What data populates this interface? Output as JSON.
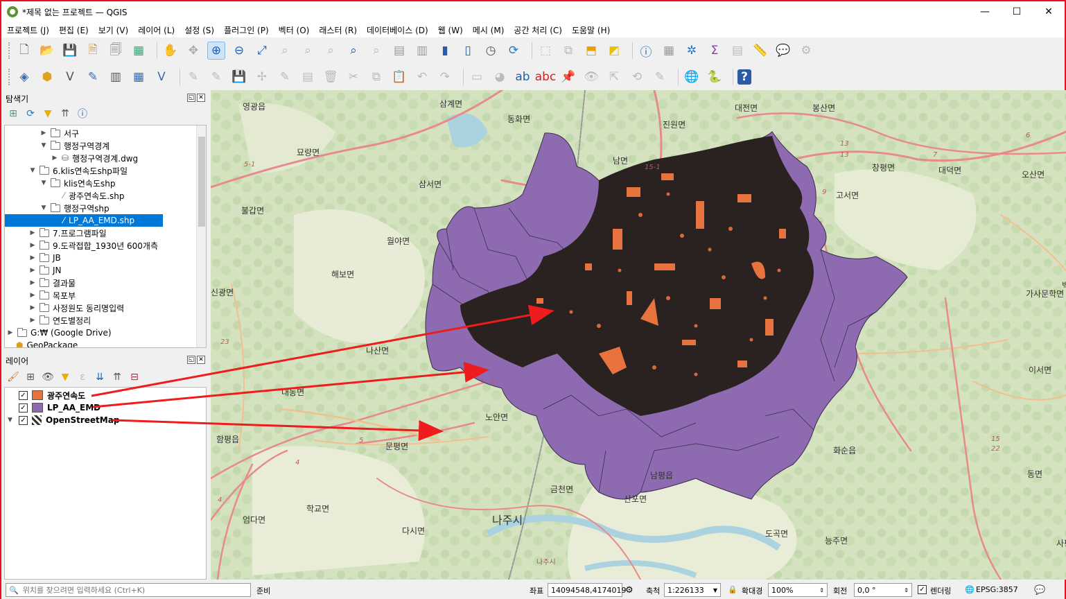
{
  "window": {
    "title": "*제목 없는 프로젝트 — QGIS",
    "minimize": "—",
    "maximize": "☐",
    "close": "✕"
  },
  "menu": [
    "프로젝트 (J)",
    "편집 (E)",
    "보기 (V)",
    "레이어 (L)",
    "설정 (S)",
    "플러그인 (P)",
    "벡터 (O)",
    "래스터 (R)",
    "데이터베이스 (D)",
    "웹 (W)",
    "메시 (M)",
    "공간 처리 (C)",
    "도움말 (H)"
  ],
  "browser_panel": {
    "title": "탐색기",
    "tree": [
      {
        "label": "서구",
        "level": 3,
        "arrow": "▶",
        "kind": "folder"
      },
      {
        "label": "행정구역경계",
        "level": 3,
        "arrow": "▼",
        "kind": "folder"
      },
      {
        "label": "행정구역경계.dwg",
        "level": 4,
        "arrow": "▶",
        "kind": "db"
      },
      {
        "label": "6.klis연속도shp파일",
        "level": 2,
        "arrow": "▼",
        "kind": "folder"
      },
      {
        "label": "klis연속도shp",
        "level": 3,
        "arrow": "▼",
        "kind": "folder"
      },
      {
        "label": "광주연속도.shp",
        "level": 4,
        "arrow": "",
        "kind": "shp"
      },
      {
        "label": "행정구역shp",
        "level": 3,
        "arrow": "▼",
        "kind": "folder"
      },
      {
        "label": "LP_AA_EMD.shp",
        "level": 4,
        "arrow": "",
        "kind": "shp",
        "selected": true
      },
      {
        "label": "7.프로그램파일",
        "level": 2,
        "arrow": "▶",
        "kind": "folder"
      },
      {
        "label": "9.도곽접합_1930년 600개측",
        "level": 2,
        "arrow": "▶",
        "kind": "folder"
      },
      {
        "label": "JB",
        "level": 2,
        "arrow": "▶",
        "kind": "folder"
      },
      {
        "label": "JN",
        "level": 2,
        "arrow": "▶",
        "kind": "folder"
      },
      {
        "label": "결과물",
        "level": 2,
        "arrow": "▶",
        "kind": "folder"
      },
      {
        "label": "목포부",
        "level": 2,
        "arrow": "▶",
        "kind": "folder"
      },
      {
        "label": "사정원도 동리명입력",
        "level": 2,
        "arrow": "▶",
        "kind": "folder"
      },
      {
        "label": "연도별정리",
        "level": 2,
        "arrow": "▶",
        "kind": "folder"
      },
      {
        "label": "G:₩ (Google Drive)",
        "level": 0,
        "arrow": "▶",
        "kind": "folder"
      },
      {
        "label": "GeoPackage",
        "level": 0,
        "arrow": "",
        "kind": "gpkg"
      }
    ]
  },
  "layers_panel": {
    "title": "레이어",
    "layers": [
      {
        "name": "광주연속도",
        "checked": "✓",
        "color": "#e8733f"
      },
      {
        "name": "LP_AA_EMD",
        "checked": "✓",
        "color": "#8e6bb1"
      },
      {
        "name": "OpenStreetMap",
        "checked": "✓",
        "color": "raster"
      }
    ]
  },
  "map_labels": [
    "영광읍",
    "삼계면",
    "동화면",
    "대전면",
    "봉산면",
    "묘량면",
    "진원면",
    "남면",
    "창평면",
    "대덕면",
    "오산면",
    "삼서면",
    "고서면",
    "불갑면",
    "월야면",
    "해보면",
    "가사문학면",
    "백아면",
    "신광면",
    "나산면",
    "이서면",
    "대동면",
    "노안면",
    "함평읍",
    "문평면",
    "화순읍",
    "동면",
    "남평읍",
    "금천면",
    "산포면",
    "학교면",
    "엄다면",
    "나주시",
    "다시면",
    "도곡면",
    "능주면",
    "사평면",
    "나주시"
  ],
  "road_labels": [
    "5-1",
    "15-1",
    "13",
    "13",
    "7",
    "6",
    "9",
    "23",
    "6",
    "4",
    "5",
    "15",
    "22",
    "4"
  ],
  "status": {
    "locator_placeholder": "위치를 찾으려면 입력하세요 (Ctrl+K)",
    "ready": "준비",
    "coord_label": "좌표",
    "coord_value": "14094548,4174019",
    "scale_label": "축척",
    "scale_value": "1:226133",
    "magnifier_label": "확대경",
    "magnifier_value": "100%",
    "rotation_label": "회전",
    "rotation_value": "0,0 °",
    "render_label": "렌더링",
    "crs": "EPSG:3857"
  },
  "colors": {
    "accent": "#0078d7",
    "emd_fill": "#8e6bb1",
    "parcel_fill": "#e8733f",
    "parcel_dark": "#2a2220",
    "arrow": "#ee1c1c",
    "border": "#e81123"
  }
}
